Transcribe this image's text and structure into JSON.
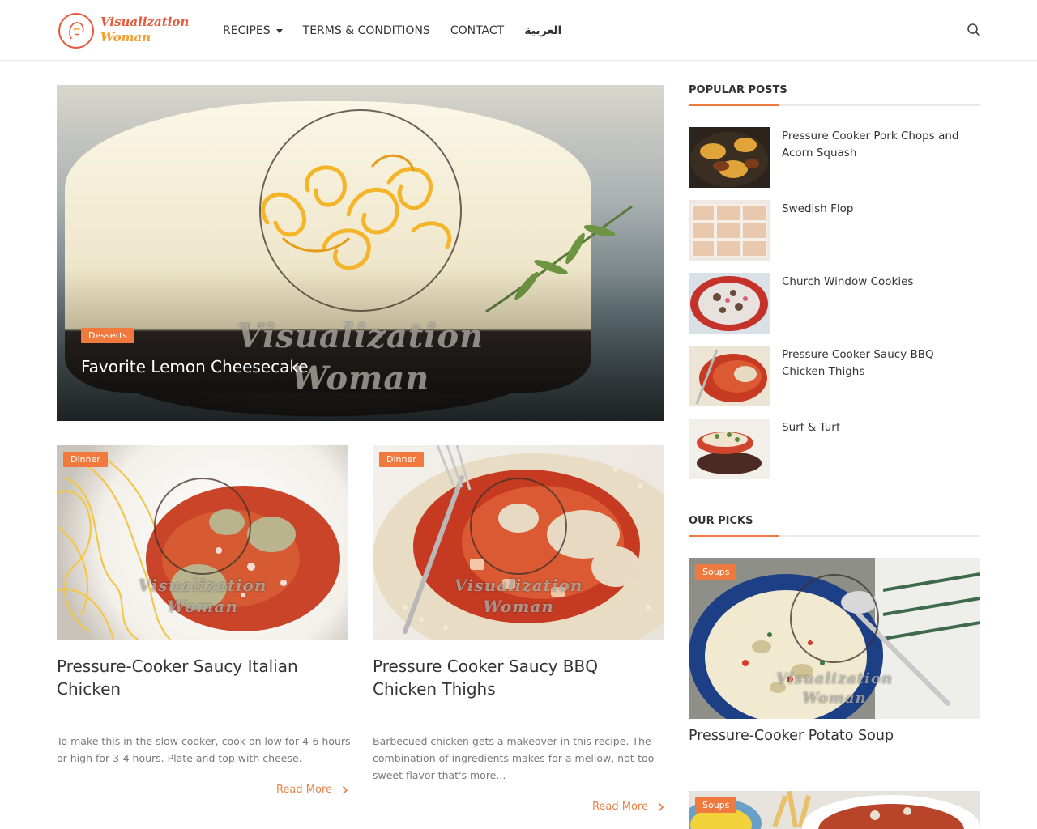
{
  "site": {
    "logo_line1": "Visualization",
    "logo_line2": "Woman",
    "accent_color": "#f07a3e"
  },
  "nav": {
    "items": [
      {
        "label": "RECIPES",
        "has_dropdown": true
      },
      {
        "label": "TERMS & CONDITIONS",
        "has_dropdown": false
      },
      {
        "label": "CONTACT",
        "has_dropdown": false
      },
      {
        "label": "العربية",
        "has_dropdown": false
      }
    ],
    "search_icon": "search-icon"
  },
  "watermark": {
    "line1": "Visualization",
    "line2": "Woman"
  },
  "hero": {
    "category": "Desserts",
    "title": "Favorite Lemon Cheesecake"
  },
  "cards": [
    {
      "category": "Dinner",
      "title": "Pressure-Cooker Saucy Italian Chicken",
      "excerpt": "To make this in the slow cooker, cook on low for 4-6 hours or high for 3-4 hours. Plate and top with cheese.",
      "read_more": "Read More"
    },
    {
      "category": "Dinner",
      "title": "Pressure Cooker Saucy BBQ Chicken Thighs",
      "excerpt": "Barbecued chicken gets a makeover in this recipe. The combination of ingredients makes for a mellow, not-too-sweet flavor that's more...",
      "read_more": "Read More"
    }
  ],
  "sidebar": {
    "popular_title": "POPULAR POSTS",
    "popular": [
      {
        "title": "Pressure Cooker Pork Chops and Acorn Squash"
      },
      {
        "title": "Swedish Flop"
      },
      {
        "title": "Church Window Cookies"
      },
      {
        "title": "Pressure Cooker Saucy BBQ Chicken Thighs"
      },
      {
        "title": "Surf & Turf"
      }
    ],
    "picks_title": "OUR PICKS",
    "picks": [
      {
        "category": "Soups",
        "title": "Pressure-Cooker Potato Soup"
      },
      {
        "category": "Soups",
        "title": ""
      }
    ]
  }
}
